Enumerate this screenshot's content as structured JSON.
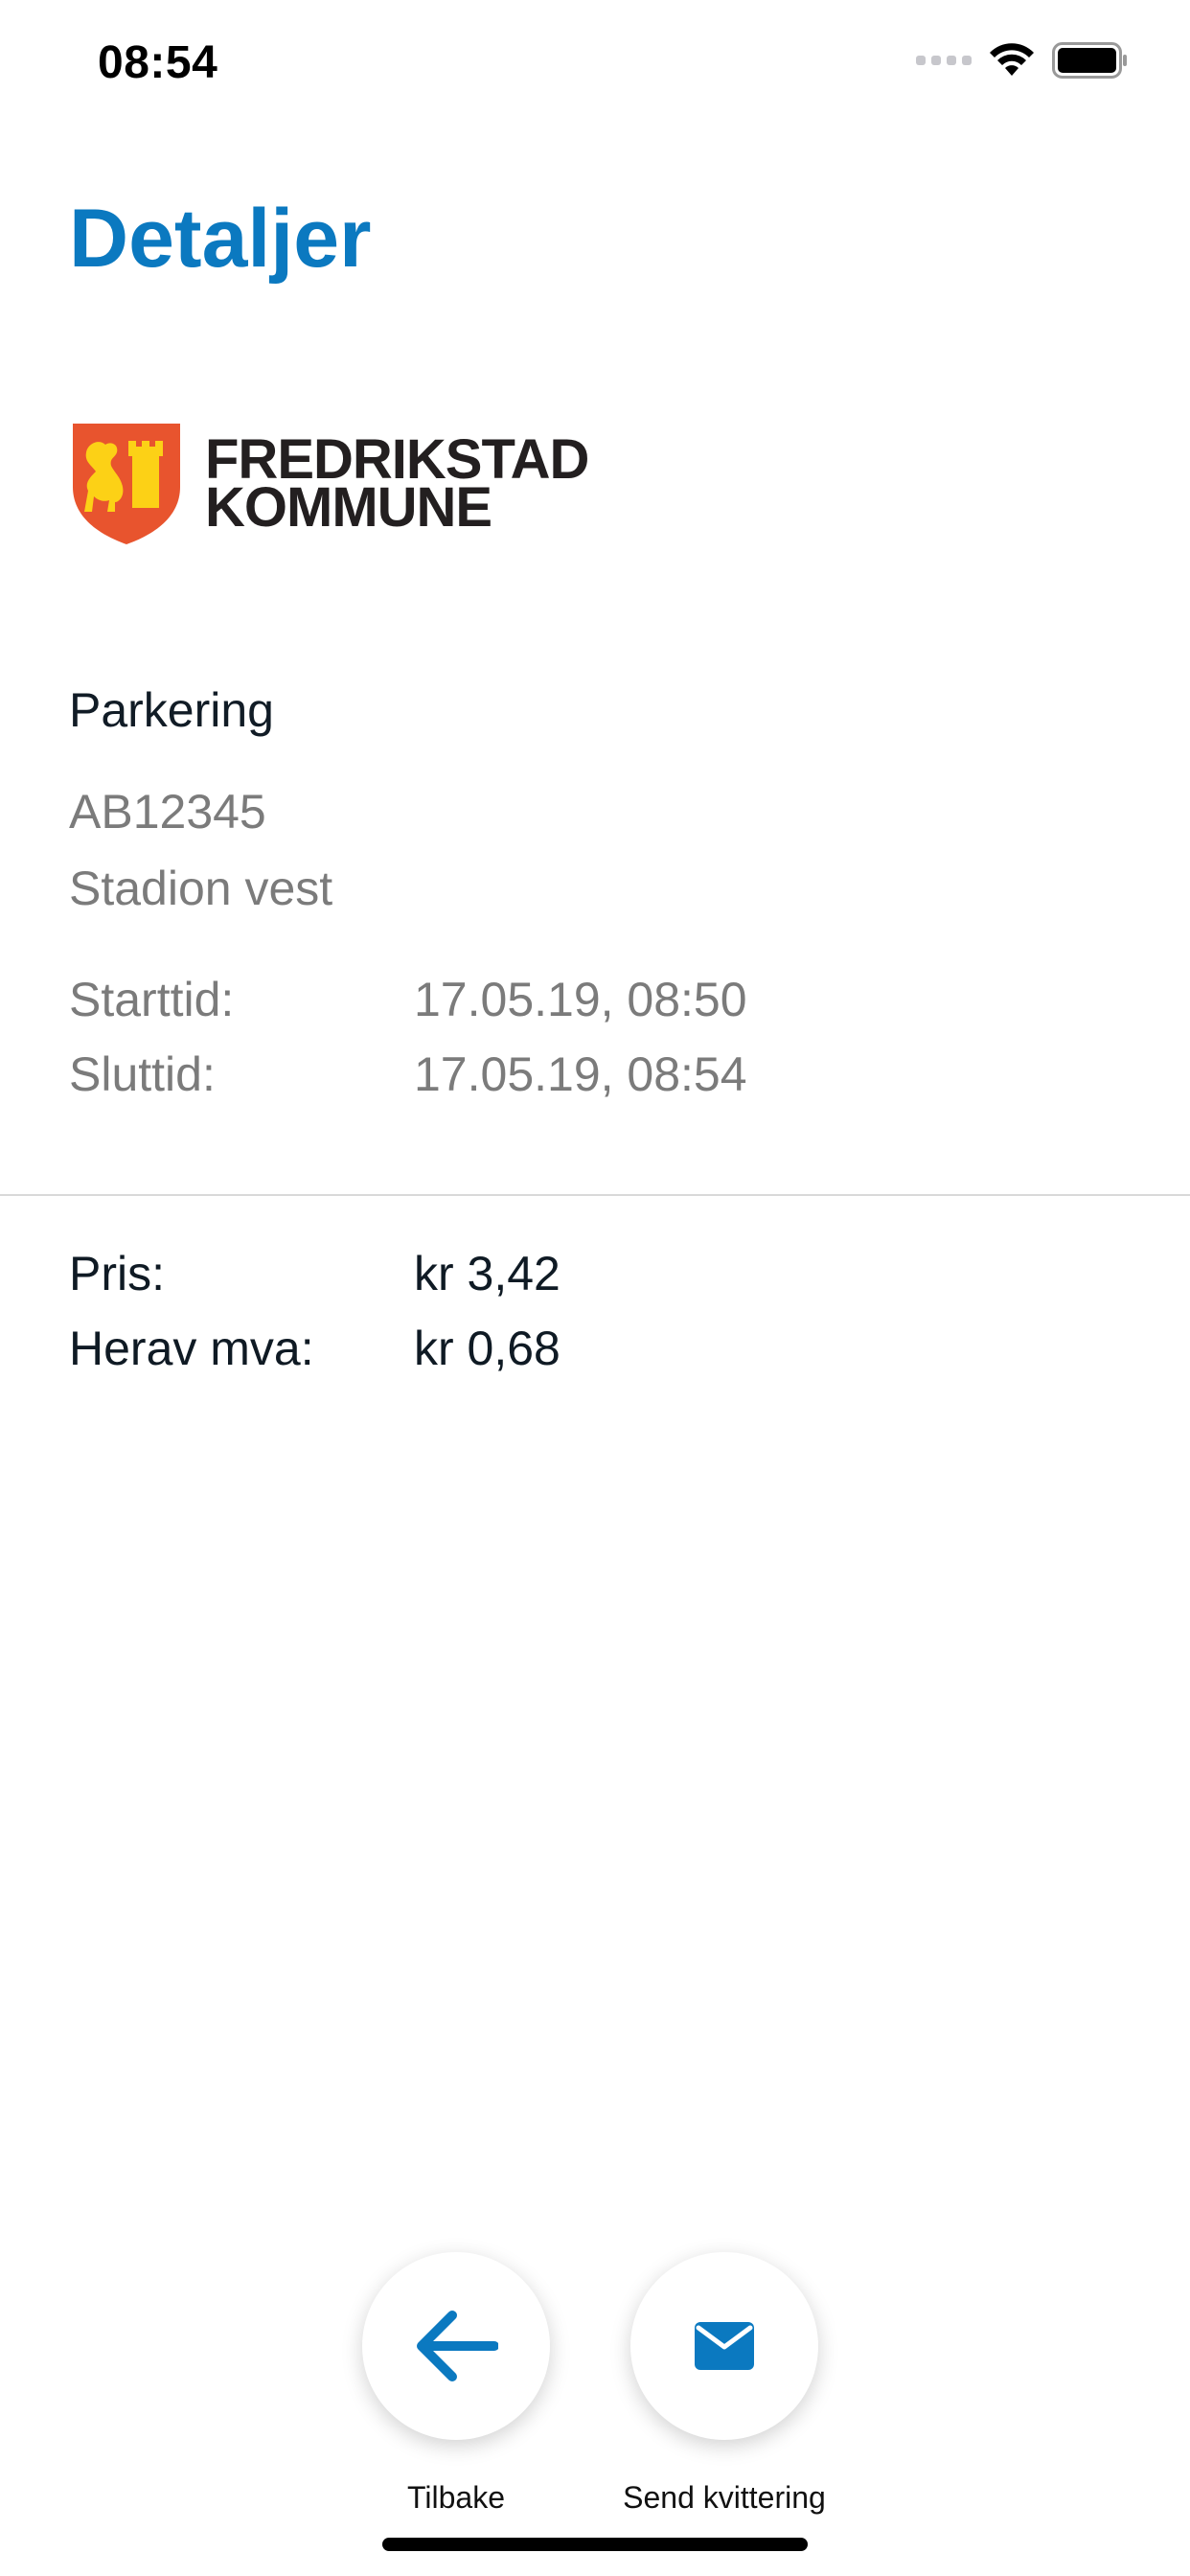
{
  "status_bar": {
    "time": "08:54",
    "icons": [
      "signal-dots-icon",
      "wifi-icon",
      "battery-icon"
    ]
  },
  "header": {
    "title": "Detaljer",
    "title_color": "#0b79c0"
  },
  "logo": {
    "line1": "FREDRIKSTAD",
    "line2": "KOMMUNE",
    "shield_colors": [
      "#e8542e",
      "#fcd116"
    ]
  },
  "details": {
    "heading": "Parkering",
    "plate": "AB12345",
    "location": "Stadion vest",
    "start_label": "Starttid:",
    "start_value": "17.05.19, 08:50",
    "end_label": "Sluttid:",
    "end_value": "17.05.19, 08:54"
  },
  "price": {
    "price_label": "Pris:",
    "price_value": "kr 3,42",
    "vat_label": "Herav mva:",
    "vat_value": "kr 0,68"
  },
  "actions": {
    "back_label": "Tilbake",
    "back_icon": "arrow-left-icon",
    "send_label": "Send kvittering",
    "send_icon": "envelope-icon",
    "accent": "#0b79c0"
  }
}
